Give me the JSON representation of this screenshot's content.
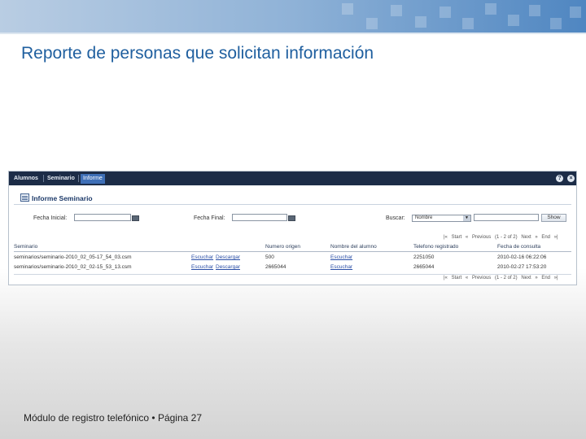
{
  "slide": {
    "title": "Reporte de personas que solicitan información",
    "footer": "Módulo de registro telefónico • Página 27"
  },
  "app": {
    "tabs": [
      "Alumnos",
      "Seminario",
      "Informe"
    ],
    "active_tab": "Informe",
    "header_icons": [
      "help-icon",
      "close-icon"
    ],
    "title": "Informe Seminario",
    "filters": {
      "fecha_inicial_label": "Fecha Inicial:",
      "fecha_inicial_value": "",
      "fecha_final_label": "Fecha Final:",
      "fecha_final_value": "",
      "buscar_label": "Buscar:",
      "buscar_select": "Nombre",
      "buscar_value": "",
      "show_button": "Show"
    },
    "pager": {
      "start": "Start",
      "previous": "Previous",
      "range": "(1 - 2 of 2)",
      "next": "Next",
      "end": "End"
    },
    "columns": [
      "Seminario",
      "Numero origen",
      "Nombre del alumno",
      "Telefono registrado",
      "Fecha de consulta"
    ],
    "rows": [
      {
        "seminario": "seminarios/seminario-2010_02_05-17_54_03.csm",
        "escuchar": "Escuchar",
        "descargar": "Descargar",
        "numero": "500",
        "alumno": "Escuchar",
        "telefono": "2251050",
        "fecha": "2010-02-16 06:22:06"
      },
      {
        "seminario": "seminarios/seminario-2010_02_02-15_53_13.csm",
        "escuchar": "Escuchar",
        "descargar": "Descargar",
        "numero": "2665044",
        "alumno": "Escuchar",
        "telefono": "2665044",
        "fecha": "2010-02-27 17:53:20"
      }
    ]
  },
  "colors": {
    "title": "#1f5f9f",
    "tabbar": "#1c2c47",
    "active_tab": "#3e6fb7",
    "link": "#2a4ea6"
  }
}
